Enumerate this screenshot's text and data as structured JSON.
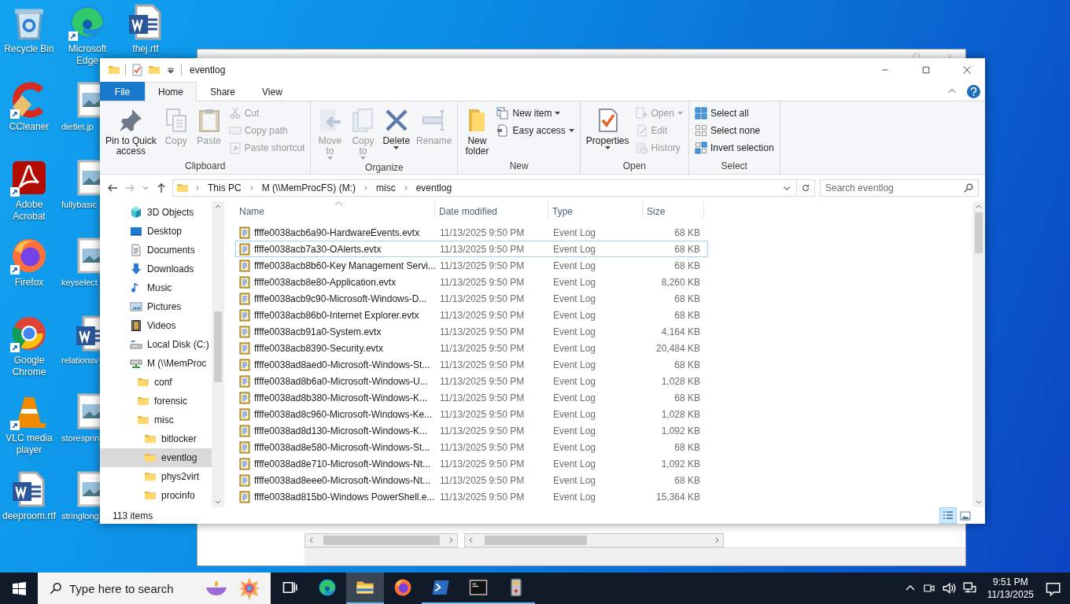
{
  "desktop_icons": [
    {
      "label": "Recycle Bin",
      "kind": "recycle",
      "shortcut": false
    },
    {
      "label": "CCleaner",
      "kind": "ccleaner",
      "shortcut": true
    },
    {
      "label": "Adobe Acrobat",
      "kind": "acrobat",
      "shortcut": true
    },
    {
      "label": "Firefox",
      "kind": "firefox",
      "shortcut": true
    },
    {
      "label": "Google Chrome",
      "kind": "chrome",
      "shortcut": true
    },
    {
      "label": "VLC media player",
      "kind": "vlc",
      "shortcut": true
    },
    {
      "label": "deeproom.rtf",
      "kind": "word",
      "shortcut": false
    },
    {
      "label": "Microsoft Edge",
      "kind": "edge",
      "shortcut": true
    },
    {
      "label": "dietlet.jp",
      "kind": "image",
      "shortcut": false
    },
    {
      "label": "fullybasic",
      "kind": "image",
      "shortcut": false
    },
    {
      "label": "keyselect",
      "kind": "image",
      "shortcut": false
    },
    {
      "label": "relationsv",
      "kind": "word",
      "shortcut": false
    },
    {
      "label": "storesprin",
      "kind": "image",
      "shortcut": false
    },
    {
      "label": "stringlong",
      "kind": "image",
      "shortcut": false
    },
    {
      "label": "thej.rtf",
      "kind": "word",
      "shortcut": false
    }
  ],
  "explorer": {
    "title": "eventlog",
    "tabs": [
      {
        "label": "File",
        "kind": "file",
        "selected": false
      },
      {
        "label": "Home",
        "kind": "tab",
        "selected": true
      },
      {
        "label": "Share",
        "kind": "tab",
        "selected": false
      },
      {
        "label": "View",
        "kind": "tab",
        "selected": false
      }
    ],
    "ribbon": [
      {
        "label": "Clipboard",
        "large": [
          {
            "label": "Pin to Quick\naccess",
            "kind": "pin",
            "disabled": false,
            "dropdown": false
          },
          {
            "label": "Copy",
            "kind": "copy",
            "disabled": true,
            "dropdown": false
          },
          {
            "label": "Paste",
            "kind": "paste",
            "disabled": true,
            "dropdown": false
          }
        ],
        "small": [
          {
            "label": "Cut",
            "kind": "cut",
            "disabled": true,
            "dropdown": false
          },
          {
            "label": "Copy path",
            "kind": "copypath",
            "disabled": true,
            "dropdown": false
          },
          {
            "label": "Paste shortcut",
            "kind": "pasteshortcut",
            "disabled": true,
            "dropdown": false
          }
        ]
      },
      {
        "label": "Organize",
        "large": [
          {
            "label": "Move\nto",
            "kind": "moveto",
            "disabled": true,
            "dropdown": true
          },
          {
            "label": "Copy\nto",
            "kind": "copyto",
            "disabled": true,
            "dropdown": true
          },
          {
            "label": "Delete",
            "kind": "delete",
            "disabled": false,
            "dropdown": true
          },
          {
            "label": "Rename",
            "kind": "rename",
            "disabled": true,
            "dropdown": false
          }
        ]
      },
      {
        "label": "New",
        "large": [
          {
            "label": "New\nfolder",
            "kind": "newfolder",
            "disabled": false,
            "dropdown": false
          }
        ],
        "small": [
          {
            "label": "New item",
            "kind": "newitem",
            "disabled": false,
            "dropdown": true
          },
          {
            "label": "Easy access",
            "kind": "easyaccess",
            "disabled": false,
            "dropdown": true
          }
        ]
      },
      {
        "label": "Open",
        "large": [
          {
            "label": "Properties",
            "kind": "properties",
            "disabled": false,
            "dropdown": true
          }
        ],
        "small": [
          {
            "label": "Open",
            "kind": "open",
            "disabled": true,
            "dropdown": true
          },
          {
            "label": "Edit",
            "kind": "edit",
            "disabled": true,
            "dropdown": false
          },
          {
            "label": "History",
            "kind": "history",
            "disabled": true,
            "dropdown": false
          }
        ]
      },
      {
        "label": "Select",
        "small": [
          {
            "label": "Select all",
            "kind": "selectall",
            "disabled": false,
            "dropdown": false
          },
          {
            "label": "Select none",
            "kind": "selectnone",
            "disabled": false,
            "dropdown": false
          },
          {
            "label": "Invert selection",
            "kind": "invert",
            "disabled": false,
            "dropdown": false
          }
        ]
      }
    ],
    "breadcrumbs": [
      "This PC",
      "M (\\\\MemProcFS) (M:)",
      "misc",
      "eventlog"
    ],
    "search": {
      "placeholder": "Search eventlog"
    },
    "nav": [
      {
        "label": "3D Objects",
        "kind": "cube",
        "selected": false
      },
      {
        "label": "Desktop",
        "kind": "desktop",
        "selected": false
      },
      {
        "label": "Documents",
        "kind": "document",
        "selected": false
      },
      {
        "label": "Downloads",
        "kind": "download",
        "selected": false
      },
      {
        "label": "Music",
        "kind": "music",
        "selected": false
      },
      {
        "label": "Pictures",
        "kind": "picture",
        "selected": false
      },
      {
        "label": "Videos",
        "kind": "video",
        "selected": false
      },
      {
        "label": "Local Disk (C:)",
        "kind": "disk",
        "selected": false
      },
      {
        "label": "M (\\\\MemProc",
        "kind": "netdrive",
        "selected": false,
        "children": [
          {
            "label": "conf",
            "kind": "folder",
            "selected": false
          },
          {
            "label": "forensic",
            "kind": "folder",
            "selected": false
          },
          {
            "label": "misc",
            "kind": "folder",
            "selected": false,
            "children": [
              {
                "label": "bitlocker",
                "kind": "folder",
                "selected": false
              },
              {
                "label": "eventlog",
                "kind": "folder",
                "selected": true
              },
              {
                "label": "phys2virt",
                "kind": "folder",
                "selected": false
              },
              {
                "label": "procinfo",
                "kind": "folder",
                "selected": false
              }
            ]
          }
        ]
      }
    ],
    "columns": [
      "Name",
      "Date modified",
      "Type",
      "Size"
    ],
    "rows": [
      {
        "name": "ffffe0038acb6a90-HardwareEvents.evtx",
        "date": "11/13/2025 9:50 PM",
        "type": "Event Log",
        "size": "68 KB",
        "focused": false
      },
      {
        "name": "ffffe0038acb7a30-OAlerts.evtx",
        "date": "11/13/2025 9:50 PM",
        "type": "Event Log",
        "size": "68 KB",
        "focused": true
      },
      {
        "name": "ffffe0038acb8b60-Key Management Servi...",
        "date": "11/13/2025 9:50 PM",
        "type": "Event Log",
        "size": "68 KB",
        "focused": false
      },
      {
        "name": "ffffe0038acb8e80-Application.evtx",
        "date": "11/13/2025 9:50 PM",
        "type": "Event Log",
        "size": "8,260 KB",
        "focused": false
      },
      {
        "name": "ffffe0038acb9c90-Microsoft-Windows-D...",
        "date": "11/13/2025 9:50 PM",
        "type": "Event Log",
        "size": "68 KB",
        "focused": false
      },
      {
        "name": "ffffe0038acb86b0-Internet Explorer.evtx",
        "date": "11/13/2025 9:50 PM",
        "type": "Event Log",
        "size": "68 KB",
        "focused": false
      },
      {
        "name": "ffffe0038acb91a0-System.evtx",
        "date": "11/13/2025 9:50 PM",
        "type": "Event Log",
        "size": "4,164 KB",
        "focused": false
      },
      {
        "name": "ffffe0038acb8390-Security.evtx",
        "date": "11/13/2025 9:50 PM",
        "type": "Event Log",
        "size": "20,484 KB",
        "focused": false
      },
      {
        "name": "ffffe0038ad8aed0-Microsoft-Windows-St...",
        "date": "11/13/2025 9:50 PM",
        "type": "Event Log",
        "size": "68 KB",
        "focused": false
      },
      {
        "name": "ffffe0038ad8b6a0-Microsoft-Windows-U...",
        "date": "11/13/2025 9:50 PM",
        "type": "Event Log",
        "size": "1,028 KB",
        "focused": false
      },
      {
        "name": "ffffe0038ad8b380-Microsoft-Windows-K...",
        "date": "11/13/2025 9:50 PM",
        "type": "Event Log",
        "size": "68 KB",
        "focused": false
      },
      {
        "name": "ffffe0038ad8c960-Microsoft-Windows-Ke...",
        "date": "11/13/2025 9:50 PM",
        "type": "Event Log",
        "size": "1,028 KB",
        "focused": false
      },
      {
        "name": "ffffe0038ad8d130-Microsoft-Windows-K...",
        "date": "11/13/2025 9:50 PM",
        "type": "Event Log",
        "size": "1,092 KB",
        "focused": false
      },
      {
        "name": "ffffe0038ad8e580-Microsoft-Windows-St...",
        "date": "11/13/2025 9:50 PM",
        "type": "Event Log",
        "size": "68 KB",
        "focused": false
      },
      {
        "name": "ffffe0038ad8e710-Microsoft-Windows-Nt...",
        "date": "11/13/2025 9:50 PM",
        "type": "Event Log",
        "size": "1,092 KB",
        "focused": false
      },
      {
        "name": "ffffe0038ad8eee0-Microsoft-Windows-Nt...",
        "date": "11/13/2025 9:50 PM",
        "type": "Event Log",
        "size": "68 KB",
        "focused": false
      },
      {
        "name": "ffffe0038ad815b0-Windows PowerShell.e...",
        "date": "11/13/2025 9:50 PM",
        "type": "Event Log",
        "size": "15,364 KB",
        "focused": false
      }
    ],
    "status": "113 items",
    "views": [
      {
        "kind": "details",
        "selected": true
      },
      {
        "kind": "largeicons",
        "selected": false
      }
    ]
  },
  "taskbar": {
    "search": {
      "placeholder": "Type here to search"
    },
    "apps": [
      {
        "kind": "edge",
        "active": false,
        "running": false
      },
      {
        "kind": "explorer",
        "active": true,
        "running": true
      },
      {
        "kind": "firefox",
        "active": false,
        "running": false
      },
      {
        "kind": "powershell",
        "active": false,
        "running": true
      },
      {
        "kind": "terminal",
        "active": false,
        "running": true
      },
      {
        "kind": "app",
        "active": false,
        "running": true
      }
    ],
    "time": "9:51 PM",
    "date": "11/13/2025"
  }
}
